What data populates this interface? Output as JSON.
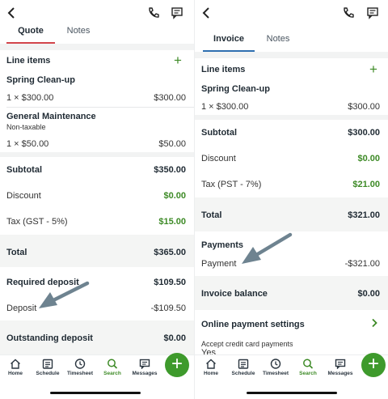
{
  "colors": {
    "accent_green": "#3d8a26",
    "quote_tab_underline": "#d2454b",
    "invoice_tab_underline": "#2f6fb0"
  },
  "left": {
    "tabs": [
      "Quote",
      "Notes"
    ],
    "line_items_title": "Line items",
    "item1_name": "Spring Clean-up",
    "item1_qty": "1 × $300.00",
    "item1_total": "$300.00",
    "item2_name": "General Maintenance",
    "item2_note": "Non-taxable",
    "item2_qty": "1 × $50.00",
    "item2_total": "$50.00",
    "subtotal_label": "Subtotal",
    "subtotal_value": "$350.00",
    "discount_label": "Discount",
    "discount_value": "$0.00",
    "tax_label": "Tax (GST - 5%)",
    "tax_value": "$15.00",
    "total_label": "Total",
    "total_value": "$365.00",
    "required_deposit_label": "Required deposit",
    "required_deposit_value": "$109.50",
    "deposit_label": "Deposit",
    "deposit_value": "-$109.50",
    "outstanding_label": "Outstanding deposit",
    "outstanding_value": "$0.00"
  },
  "right": {
    "tabs": [
      "Invoice",
      "Notes"
    ],
    "line_items_title": "Line items",
    "item1_name": "Spring Clean-up",
    "item1_qty": "1 × $300.00",
    "item1_total": "$300.00",
    "subtotal_label": "Subtotal",
    "subtotal_value": "$300.00",
    "discount_label": "Discount",
    "discount_value": "$0.00",
    "tax_label": "Tax (PST - 7%)",
    "tax_value": "$21.00",
    "total_label": "Total",
    "total_value": "$321.00",
    "payments_label": "Payments",
    "payment_label": "Payment",
    "payment_value": "-$321.00",
    "balance_label": "Invoice balance",
    "balance_value": "$0.00",
    "online_label": "Online payment settings",
    "cc_label": "Accept credit card payments",
    "cc_value": "Yes"
  },
  "nav": {
    "items": [
      "Home",
      "Schedule",
      "Timesheet",
      "Search",
      "Messages"
    ],
    "active": "Search",
    "fab_icon": "plus-icon",
    "icons": [
      "home-icon",
      "schedule-icon",
      "timesheet-icon",
      "search-icon",
      "messages-icon"
    ]
  }
}
